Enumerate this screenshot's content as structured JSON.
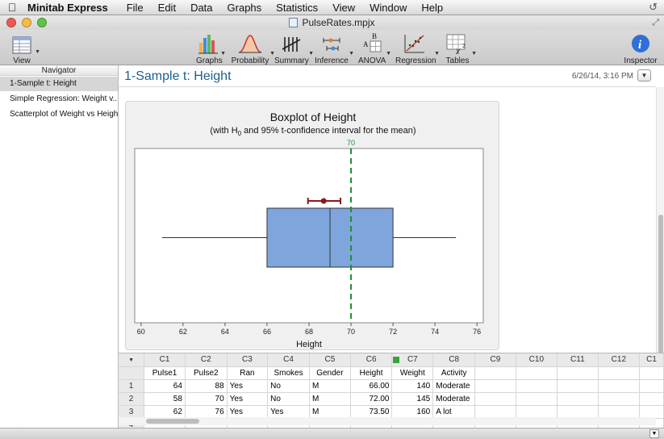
{
  "menubar": {
    "app_name": "Minitab Express",
    "items": [
      "File",
      "Edit",
      "Data",
      "Graphs",
      "Statistics",
      "View",
      "Window",
      "Help"
    ]
  },
  "window": {
    "title": "PulseRates.mpjx"
  },
  "toolbar": {
    "view": "View",
    "graphs": "Graphs",
    "probability": "Probability",
    "summary": "Summary",
    "inference": "Inference",
    "anova": "ANOVA",
    "regression": "Regression",
    "tables": "Tables",
    "inspector": "Inspector"
  },
  "navigator": {
    "title": "Navigator",
    "items": [
      "1-Sample t: Height",
      "Simple Regression: Weight v...",
      "Scatterplot of Weight vs Height"
    ]
  },
  "main": {
    "title": "1-Sample t: Height",
    "date": "6/26/14, 3:16 PM"
  },
  "chart_data": {
    "type": "boxplot",
    "title": "Boxplot of Height",
    "subtitle_pre": "(with H",
    "subtitle_sub": "0",
    "subtitle_post": " and 95% t-confidence interval for the mean)",
    "xlabel": "Height",
    "xlim": [
      59.7,
      76.3
    ],
    "ticks": [
      60,
      62,
      64,
      66,
      68,
      70,
      72,
      74,
      76
    ],
    "box": {
      "whisker_low": 61,
      "q1": 66,
      "median": 69,
      "q3": 72,
      "whisker_high": 75
    },
    "ci": {
      "mean": 68.7,
      "low": 67.95,
      "high": 69.5
    },
    "h0": {
      "value": 70,
      "label": "70"
    },
    "colors": {
      "box": "#7ea6dc",
      "ci": "#8b1a1a",
      "h0": "#1f8f2f"
    }
  },
  "grid": {
    "col_ids": [
      "C1",
      "C2",
      "C3",
      "C4",
      "C5",
      "C6",
      "C7",
      "C8",
      "C9",
      "C10",
      "C11",
      "C12",
      "C1"
    ],
    "col_names": [
      "Pulse1",
      "Pulse2",
      "Ran",
      "Smokes",
      "Gender",
      "Height",
      "Weight",
      "Activity",
      "",
      "",
      "",
      "",
      ""
    ],
    "rows": [
      {
        "n": "1",
        "cells": [
          "64",
          "88",
          "Yes",
          "No",
          "M",
          "66.00",
          "140",
          "Moderate"
        ]
      },
      {
        "n": "2",
        "cells": [
          "58",
          "70",
          "Yes",
          "No",
          "M",
          "72.00",
          "145",
          "Moderate"
        ]
      },
      {
        "n": "3",
        "cells": [
          "62",
          "76",
          "Yes",
          "Yes",
          "M",
          "73.50",
          "160",
          "A lot"
        ]
      },
      {
        "n": "4",
        "cells": [
          "",
          "",
          "",
          "",
          "",
          "",
          "",
          ""
        ]
      }
    ]
  }
}
